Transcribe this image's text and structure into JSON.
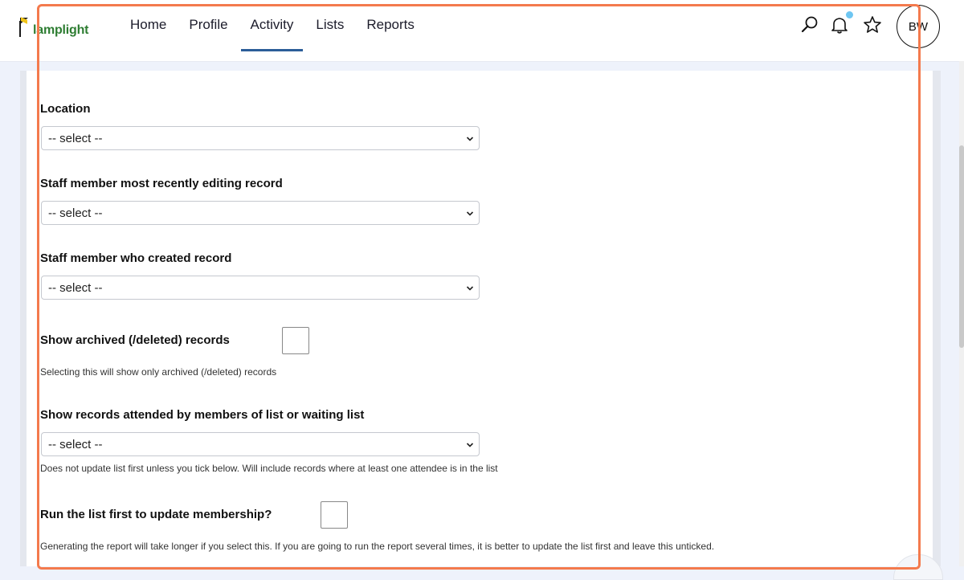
{
  "header": {
    "logo_text": "lamplight",
    "nav": [
      {
        "label": "Home",
        "active": false
      },
      {
        "label": "Profile",
        "active": false
      },
      {
        "label": "Activity",
        "active": true
      },
      {
        "label": "Lists",
        "active": false
      },
      {
        "label": "Reports",
        "active": false
      }
    ],
    "icons": [
      "search-icon",
      "notification-bell-icon",
      "favourite-star-icon"
    ],
    "avatar_initials": "BW",
    "accent_color": "#2b5d98",
    "notification_dot_color": "#6ec6f2"
  },
  "form": {
    "location": {
      "label": "Location",
      "value": "-- select --"
    },
    "last_editor": {
      "label": "Staff member most recently editing record",
      "value": "-- select --"
    },
    "creator": {
      "label": "Staff member who created record",
      "value": "-- select --"
    },
    "archived": {
      "label": "Show archived (/deleted) records",
      "checked": false,
      "help": "Selecting this will show only archived (/deleted) records"
    },
    "attended_list": {
      "label": "Show records attended by members of list or waiting list",
      "value": "-- select --",
      "help": "Does not update list first unless you tick below. Will include records where at least one attendee is in the list"
    },
    "run_list_first": {
      "label": "Run the list first to update membership?",
      "checked": false,
      "help": "Generating the report will take longer if you select this. If you are going to run the report several times, it is better to update the list first and leave this unticked."
    }
  },
  "highlight_color": "#f47a4d"
}
